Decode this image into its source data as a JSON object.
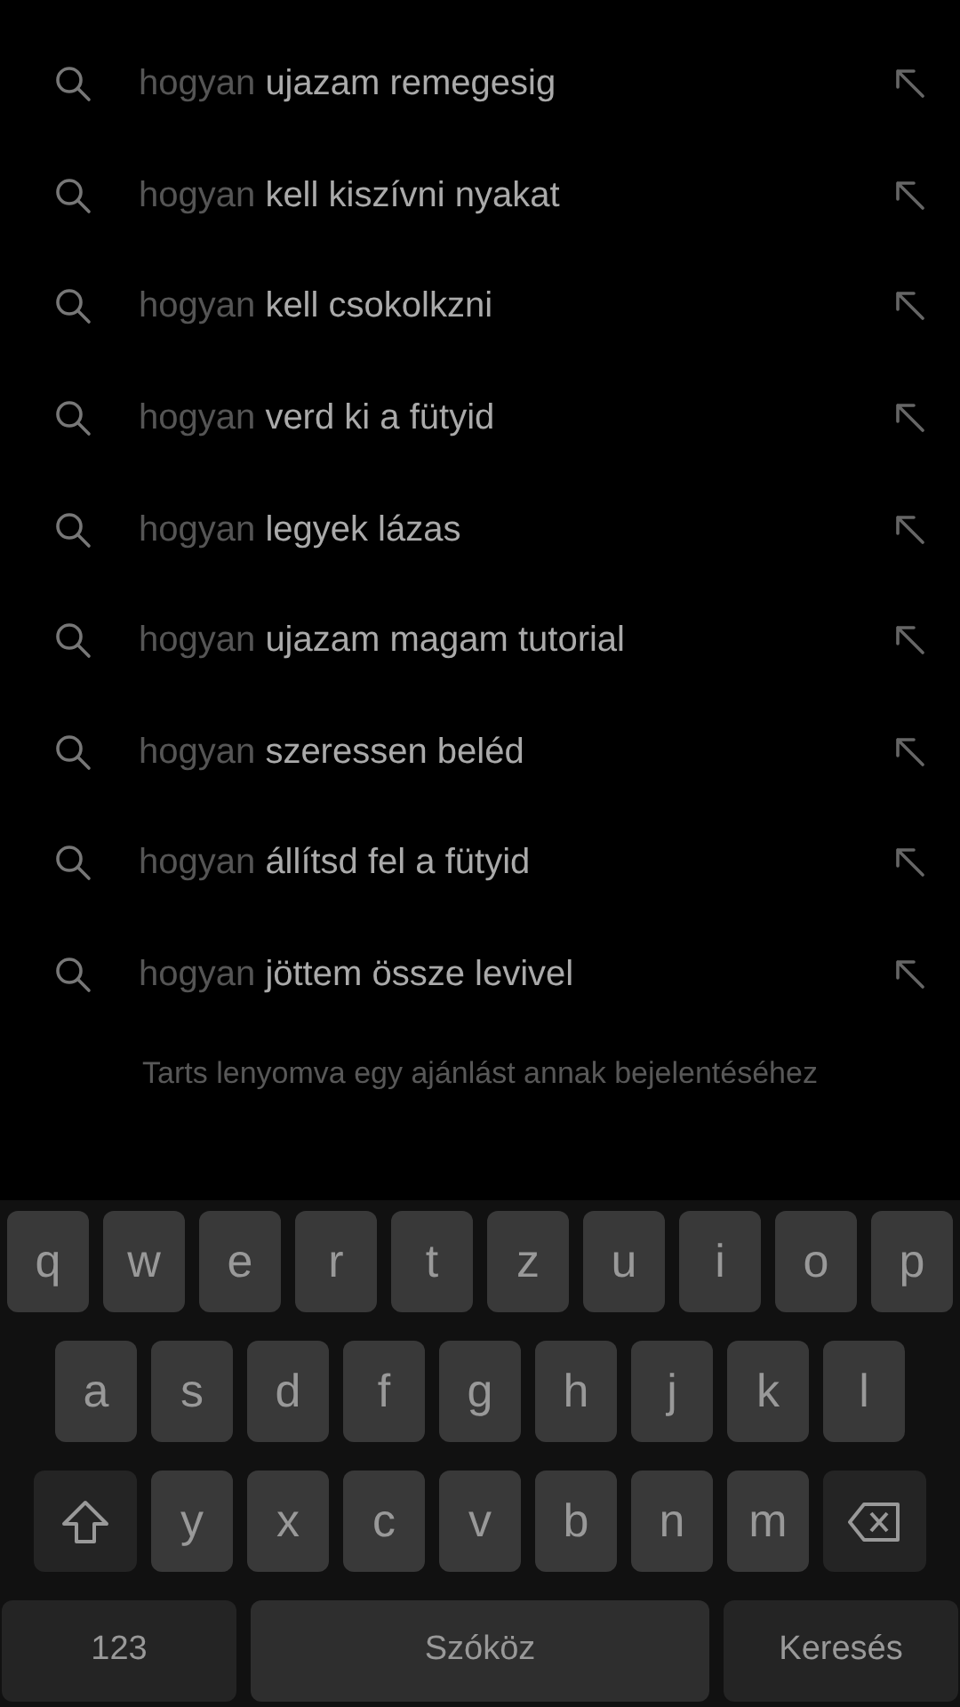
{
  "suggestions": [
    {
      "prefix": "hogyan",
      "completion": "ujazam remegesig"
    },
    {
      "prefix": "hogyan",
      "completion": "kell kiszívni nyakat"
    },
    {
      "prefix": "hogyan",
      "completion": "kell csokolkzni"
    },
    {
      "prefix": "hogyan",
      "completion": "verd ki a fütyid"
    },
    {
      "prefix": "hogyan",
      "completion": "legyek lázas"
    },
    {
      "prefix": "hogyan",
      "completion": "ujazam magam tutorial"
    },
    {
      "prefix": "hogyan",
      "completion": "szeressen beléd"
    },
    {
      "prefix": "hogyan",
      "completion": "állítsd fel a fütyid"
    },
    {
      "prefix": "hogyan",
      "completion": "jöttem össze levivel"
    }
  ],
  "hint": "Tarts lenyomva egy ajánlást annak bejelentéséhez",
  "keyboard": {
    "rows": [
      [
        {
          "kind": "letter",
          "label": "q"
        },
        {
          "kind": "letter",
          "label": "w"
        },
        {
          "kind": "letter",
          "label": "e"
        },
        {
          "kind": "letter",
          "label": "r"
        },
        {
          "kind": "letter",
          "label": "t"
        },
        {
          "kind": "letter",
          "label": "z"
        },
        {
          "kind": "letter",
          "label": "u"
        },
        {
          "kind": "letter",
          "label": "i"
        },
        {
          "kind": "letter",
          "label": "o"
        },
        {
          "kind": "letter",
          "label": "p"
        }
      ],
      [
        {
          "kind": "letter",
          "label": "a"
        },
        {
          "kind": "letter",
          "label": "s"
        },
        {
          "kind": "letter",
          "label": "d"
        },
        {
          "kind": "letter",
          "label": "f"
        },
        {
          "kind": "letter",
          "label": "g"
        },
        {
          "kind": "letter",
          "label": "h"
        },
        {
          "kind": "letter",
          "label": "j"
        },
        {
          "kind": "letter",
          "label": "k"
        },
        {
          "kind": "letter",
          "label": "l"
        }
      ],
      [
        {
          "kind": "shift"
        },
        {
          "kind": "letter",
          "label": "y"
        },
        {
          "kind": "letter",
          "label": "x"
        },
        {
          "kind": "letter",
          "label": "c"
        },
        {
          "kind": "letter",
          "label": "v"
        },
        {
          "kind": "letter",
          "label": "b"
        },
        {
          "kind": "letter",
          "label": "n"
        },
        {
          "kind": "letter",
          "label": "m"
        },
        {
          "kind": "backspace"
        }
      ]
    ],
    "bottom_keys": [
      {
        "kind": "numbers",
        "label": "123"
      },
      {
        "kind": "space",
        "label": "Szóköz"
      },
      {
        "kind": "action",
        "label": "Keresés"
      }
    ]
  }
}
